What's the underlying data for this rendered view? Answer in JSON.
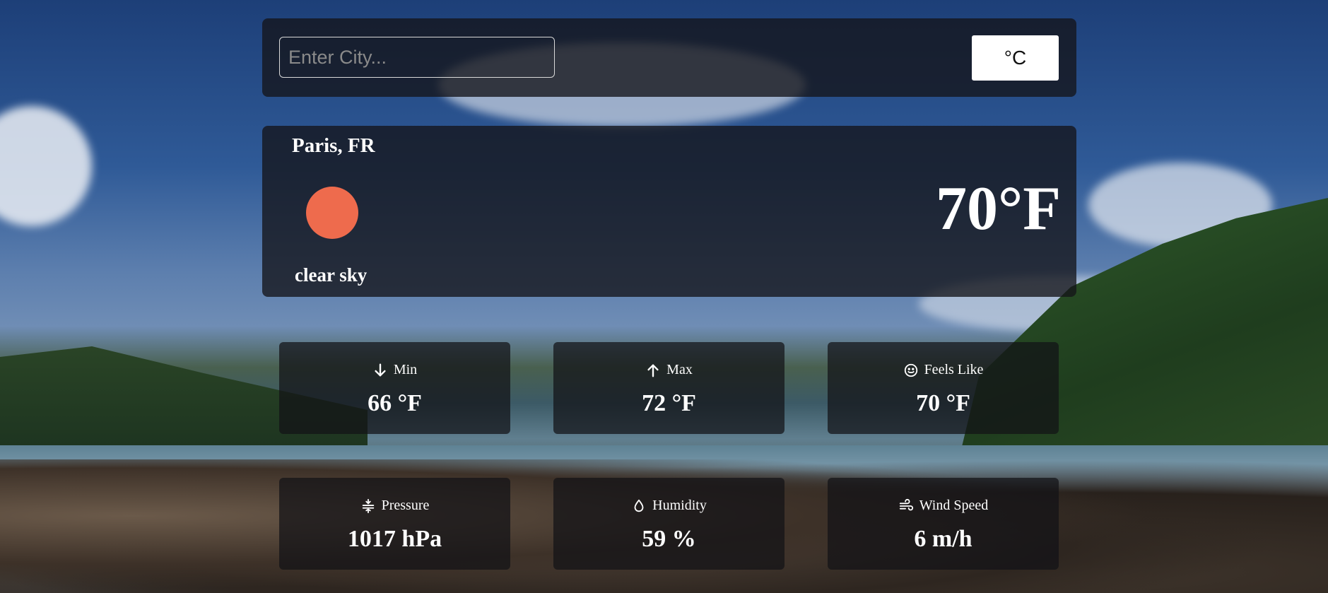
{
  "search": {
    "placeholder": "Enter City..."
  },
  "unit_toggle": {
    "label": "°C"
  },
  "weather": {
    "location": "Paris, FR",
    "description": "clear sky",
    "temperature": "70°F",
    "icon": "sun-icon",
    "icon_color": "#ee6b4d"
  },
  "stats": [
    {
      "label": "Min",
      "value": "66 °F",
      "icon": "arrow-down-icon"
    },
    {
      "label": "Max",
      "value": "72 °F",
      "icon": "arrow-up-icon"
    },
    {
      "label": "Feels Like",
      "value": "70 °F",
      "icon": "smile-icon"
    },
    {
      "label": "Pressure",
      "value": "1017 hPa",
      "icon": "pressure-icon"
    },
    {
      "label": "Humidity",
      "value": "59 %",
      "icon": "droplet-icon"
    },
    {
      "label": "Wind Speed",
      "value": "6 m/h",
      "icon": "wind-icon"
    }
  ]
}
